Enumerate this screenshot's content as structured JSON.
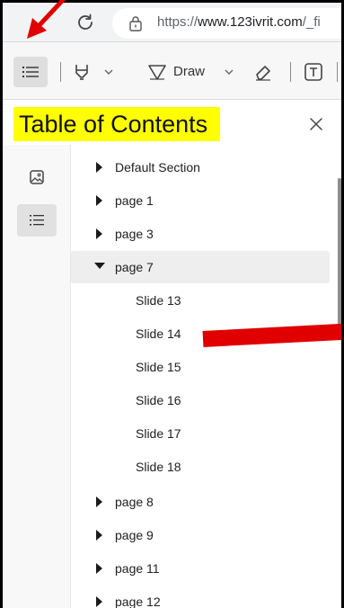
{
  "browser": {
    "url_prefix": "https://",
    "url_domain": "www.123ivrit.com",
    "url_path": "/_fi"
  },
  "toolbar": {
    "draw_label": "Draw",
    "icons": [
      "table-of-contents-icon",
      "highlight-icon",
      "draw-icon",
      "eraser-icon",
      "text-box-icon"
    ]
  },
  "panel": {
    "title": "Table of Contents",
    "highlight_color": "#ffff00"
  },
  "toc": {
    "items": [
      {
        "label": "Default Section",
        "level": 0,
        "expanded": false
      },
      {
        "label": "page 1",
        "level": 0,
        "expanded": false
      },
      {
        "label": "page 3",
        "level": 0,
        "expanded": false
      },
      {
        "label": "page 7",
        "level": 0,
        "expanded": true,
        "selected": true
      },
      {
        "label": "Slide 13",
        "level": 1
      },
      {
        "label": "Slide 14",
        "level": 1
      },
      {
        "label": "Slide 15",
        "level": 1
      },
      {
        "label": "Slide 16",
        "level": 1
      },
      {
        "label": "Slide 17",
        "level": 1
      },
      {
        "label": "Slide 18",
        "level": 1
      },
      {
        "label": "page 8",
        "level": 0,
        "expanded": false
      },
      {
        "label": "page 9",
        "level": 0,
        "expanded": false
      },
      {
        "label": "page 11",
        "level": 0,
        "expanded": false
      },
      {
        "label": "page 12",
        "level": 0,
        "expanded": false
      }
    ]
  },
  "annotations": {
    "arrow_color": "#e00000",
    "bar_color": "#e00000"
  }
}
